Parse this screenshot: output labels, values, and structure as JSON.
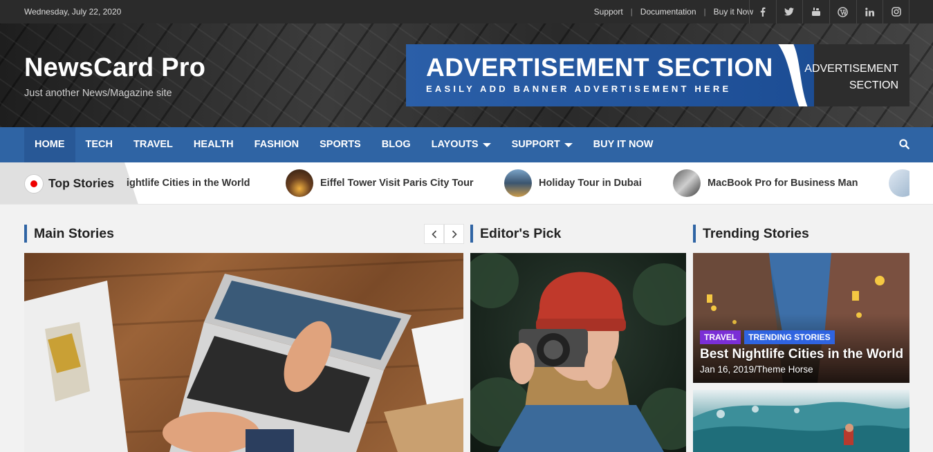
{
  "topbar": {
    "date": "Wednesday, July 22, 2020",
    "links": [
      "Support",
      "Documentation",
      "Buy it Now"
    ],
    "social_icons": [
      "facebook-icon",
      "twitter-icon",
      "youtube-icon",
      "wordpress-icon",
      "linkedin-icon",
      "instagram-icon"
    ]
  },
  "header": {
    "site_title": "NewsCard Pro",
    "tagline": "Just another News/Magazine site",
    "ad": {
      "title": "ADVERTISEMENT SECTION",
      "subtitle": "EASILY ADD BANNER ADVERTISEMENT HERE",
      "side_line1": "ADVERTISEMENT",
      "side_line2": "SECTION"
    }
  },
  "nav": {
    "items": [
      {
        "label": "HOME",
        "active": true
      },
      {
        "label": "TECH"
      },
      {
        "label": "TRAVEL"
      },
      {
        "label": "HEALTH"
      },
      {
        "label": "FASHION"
      },
      {
        "label": "SPORTS"
      },
      {
        "label": "BLOG"
      },
      {
        "label": "LAYOUTS",
        "dropdown": true
      },
      {
        "label": "SUPPORT",
        "dropdown": true
      },
      {
        "label": "BUY IT NOW"
      }
    ],
    "search_icon": "search-icon"
  },
  "ticker": {
    "label": "Top Stories",
    "items": [
      "Best Nightlife Cities in the World",
      "Eiffel Tower Visit Paris City Tour",
      "Holiday Tour in Dubai",
      "MacBook Pro for Business Man"
    ]
  },
  "sections": {
    "main": "Main Stories",
    "editor": "Editor's Pick",
    "trending": "Trending Stories"
  },
  "trending": {
    "first": {
      "categories": [
        "TRAVEL",
        "TRENDING STORIES"
      ],
      "title": "Best Nightlife Cities in the World",
      "meta": "Jan 16, 2019/Theme Horse"
    }
  },
  "colors": {
    "primary": "#2f64a4",
    "travel_badge": "#7b2fd6",
    "trending_badge": "#2f64e0"
  }
}
